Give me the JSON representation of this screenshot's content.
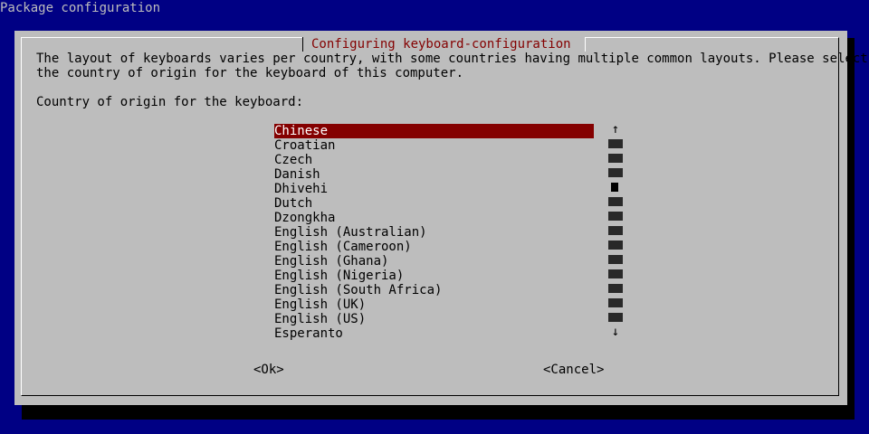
{
  "screen": {
    "title": "Package configuration"
  },
  "dialog": {
    "title": "Configuring keyboard-configuration",
    "description_lines": [
      "The layout of keyboards varies per country, with some countries having multiple common layouts. Please select",
      "the country of origin for the keyboard of this computer."
    ],
    "prompt": "Country of origin for the keyboard:",
    "list": {
      "selected_index": 0,
      "items": [
        "Chinese",
        "Croatian",
        "Czech",
        "Danish",
        "Dhivehi",
        "Dutch",
        "Dzongkha",
        "English (Australian)",
        "English (Cameroon)",
        "English (Ghana)",
        "English (Nigeria)",
        "English (South Africa)",
        "English (UK)",
        "English (US)",
        "Esperanto"
      ]
    },
    "scrollbar": {
      "up_arrow": "↑",
      "down_arrow": "↓",
      "thumb_index": 3,
      "track_cells": 13
    },
    "buttons": {
      "ok": "<Ok>",
      "cancel": "<Cancel>"
    }
  },
  "colors": {
    "background": "#000084",
    "dialog": "#bdbdbd",
    "accent": "#840000",
    "highlight_text": "#ffffff"
  }
}
